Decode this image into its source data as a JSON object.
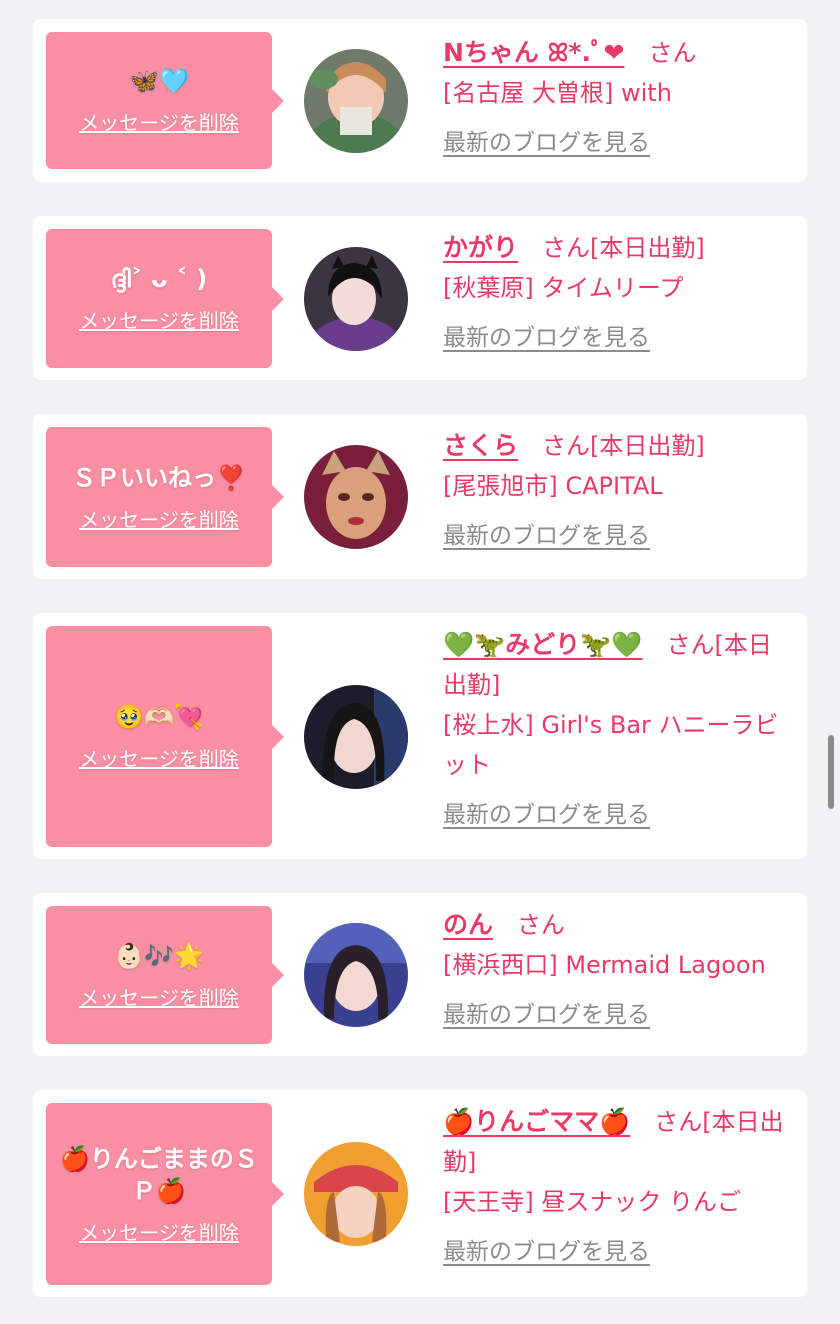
{
  "colors": {
    "background": "#f2f2f4",
    "card": "#ffffff",
    "bubble": "#fa8fa3",
    "accent": "#e83a67",
    "link_gray": "#8c8c8c"
  },
  "messages": [
    {
      "message": "🦋🩵",
      "delete_label": "メッセージを削除",
      "name": "Nちゃん ꕤ*.ﾟ❤",
      "suffix": "さん",
      "shop": "[名古屋 大曽根] with",
      "blog_link": "最新のブログを見る"
    },
    {
      "message": "ദ്ദി˃ ᴗ ˂ )",
      "delete_label": "メッセージを削除",
      "name": "かがり",
      "suffix": "さん[本日出勤]",
      "shop": "[秋葉原] タイムリープ",
      "blog_link": "最新のブログを見る"
    },
    {
      "message": "ＳＰいいねっ❣️",
      "delete_label": "メッセージを削除",
      "name": "さくら",
      "suffix": "さん[本日出勤]",
      "shop": "[尾張旭市] CAPITAL",
      "blog_link": "最新のブログを見る"
    },
    {
      "message": "🥹🫶🏻💘",
      "delete_label": "メッセージを削除",
      "name": "💚🦖みどり🦖💚",
      "suffix": "さん[本日出勤]",
      "shop": "[桜上水] Girl's Bar ハニーラビット",
      "blog_link": "最新のブログを見る"
    },
    {
      "message": "👶🏻🎶🌟",
      "delete_label": "メッセージを削除",
      "name": "のん",
      "suffix": "さん",
      "shop": "[横浜西口] Mermaid Lagoon",
      "blog_link": "最新のブログを見る"
    },
    {
      "message": "🍎りんごままのＳＰ🍎",
      "delete_label": "メッセージを削除",
      "name": "🍎りんごママ🍎",
      "suffix": "さん[本日出勤]",
      "shop": "[天王寺] 昼スナック りんご",
      "blog_link": "最新のブログを見る"
    }
  ]
}
